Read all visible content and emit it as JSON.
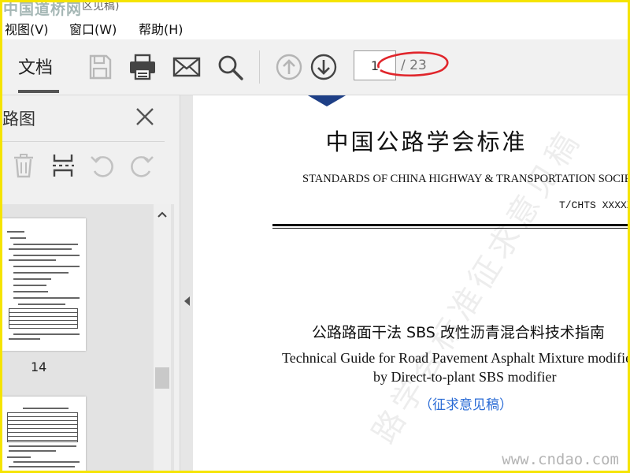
{
  "window": {
    "brand_watermark": "中国道桥网",
    "title_fragment": "区见稿)"
  },
  "menu": {
    "items": [
      {
        "label": "视图(V)"
      },
      {
        "label": "窗口(W)"
      },
      {
        "label": "帮助(H)"
      }
    ]
  },
  "toolbar": {
    "tab_document": "文档",
    "page_current": "1",
    "page_total": "/ 23",
    "icons": [
      "save-icon",
      "print-icon",
      "mail-icon",
      "search-icon",
      "previous-page-icon",
      "next-page-icon"
    ]
  },
  "sidebar": {
    "title": "路图",
    "icons": [
      "delete-icon",
      "extract-page-icon",
      "rotate-left-icon",
      "rotate-right-icon"
    ],
    "thumbnail_page_number": "14"
  },
  "document": {
    "title_cn": "中国公路学会标准",
    "title_en": "STANDARDS OF CHINA HIGHWAY & TRANSPORTATION SOCIETY",
    "code": "T/CHTS XXXXX—",
    "heading_cn": "公路路面干法 SBS 改性沥青混合料技术指南",
    "heading_en_line1": "Technical Guide for Road Pavement Asphalt Mixture modified",
    "heading_en_line2": "by Direct-to-plant SBS modifier",
    "draft_label": "（征求意见稿）",
    "watermark_text": "路学会标准征求意见稿"
  },
  "site_watermark": "www.cndao.com",
  "colors": {
    "frame_border": "#f5e400",
    "highlight_ellipse": "#e0252b",
    "draft_text": "#2b6cd6"
  }
}
